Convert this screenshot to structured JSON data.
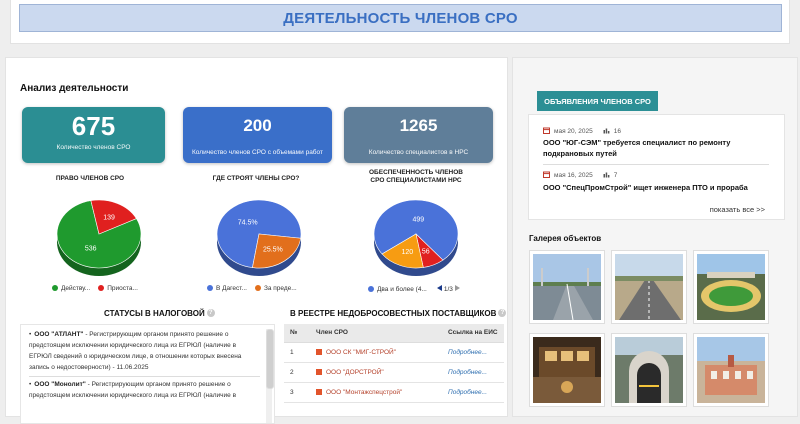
{
  "banner": {
    "title": "ДЕЯТЕЛЬНОСТЬ ЧЛЕНОВ СРО"
  },
  "analysis": {
    "title": "Анализ деятельности",
    "stats": [
      {
        "value": "675",
        "label": "Количество членов СРО",
        "color": "#2b8e93"
      },
      {
        "value": "200",
        "label": "Количество членов СРО с объемами работ",
        "color": "#3a6fc9"
      },
      {
        "value": "1265",
        "label": "Количество специалистов в НРС",
        "color": "#5f7e99"
      }
    ]
  },
  "pies": [
    {
      "title_line1": "ПРАВО ЧЛЕНОВ СРО",
      "title_line2": "",
      "slices": [
        {
          "name": "Действу...",
          "value": 536,
          "label": "536",
          "color": "#1f9a2e"
        },
        {
          "name": "Приоста...",
          "value": 139,
          "label": "139",
          "color": "#e0201f"
        }
      ]
    },
    {
      "title_line1": "ГДЕ СТРОЯТ ЧЛЕНЫ СРО?",
      "title_line2": "",
      "slices": [
        {
          "name": "В Дагест...",
          "value": 74.5,
          "label": "74.5%",
          "color": "#4a72d9"
        },
        {
          "name": "За преде...",
          "value": 25.5,
          "label": "25.5%",
          "color": "#e26f1c"
        }
      ]
    },
    {
      "title_line1": "ОБЕСПЕЧЕННОСТЬ ЧЛЕНОВ",
      "title_line2": "СРО СПЕЦИАЛИСТАМИ НРС",
      "slices": [
        {
          "name": "Два и более (4...",
          "value": 499,
          "label": "499",
          "color": "#4a72d9"
        },
        {
          "name": "",
          "value": 56,
          "label": "56",
          "color": "#e0201f"
        },
        {
          "name": "",
          "value": 120,
          "label": "120",
          "color": "#f79c12"
        }
      ],
      "pager": "1/3"
    }
  ],
  "tax": {
    "title": "СТАТУСЫ В НАЛОГОВОЙ",
    "items": [
      {
        "org": "ООО \"АТЛАНТ\"",
        "text": " - Регистрирующим органом принято решение о предстоящем исключении юридического лица из ЕГРЮЛ (наличие в ЕГРЮЛ сведений о юридическом лице, в отношении которых внесена запись о недостоверности) - 11.06.2025"
      },
      {
        "org": "ООО \"Монолит\"",
        "text": " - Регистрирующим органом принято решение о предстоящем исключении юридического лица из ЕГРЮЛ (наличие в"
      }
    ]
  },
  "suppliers": {
    "title": "В РЕЕСТРЕ НЕДОБРОСОВЕСТНЫХ ПОСТАВЩИКОВ",
    "headers": [
      "№",
      "Член СРО",
      "Ссылка на ЕИС"
    ],
    "rows": [
      {
        "num": "1",
        "member": "ООО СК \"МИГ-СТРОЙ\"",
        "link": "Подробнее..."
      },
      {
        "num": "2",
        "member": "ООО \"ДОРСТРОЙ\"",
        "link": "Подробнее..."
      },
      {
        "num": "3",
        "member": "ООО \"Монтажспецстрой\"",
        "link": "Подробнее..."
      }
    ]
  },
  "announcements": {
    "title": "ОБЪЯВЛЕНИЯ ЧЛЕНОВ СРО",
    "items": [
      {
        "date": "мая 20, 2025",
        "views": "16",
        "title": "ООО \"ЮГ-СЭМ\" требуется специалист по ремонту подкрановых путей"
      },
      {
        "date": "мая 16, 2025",
        "views": "7",
        "title": "ООО \"СпецПромСтрой\" ищет инженера ПТО и прораба"
      }
    ],
    "show_all": "показать все >>"
  },
  "gallery": {
    "title": "Галерея объектов"
  }
}
